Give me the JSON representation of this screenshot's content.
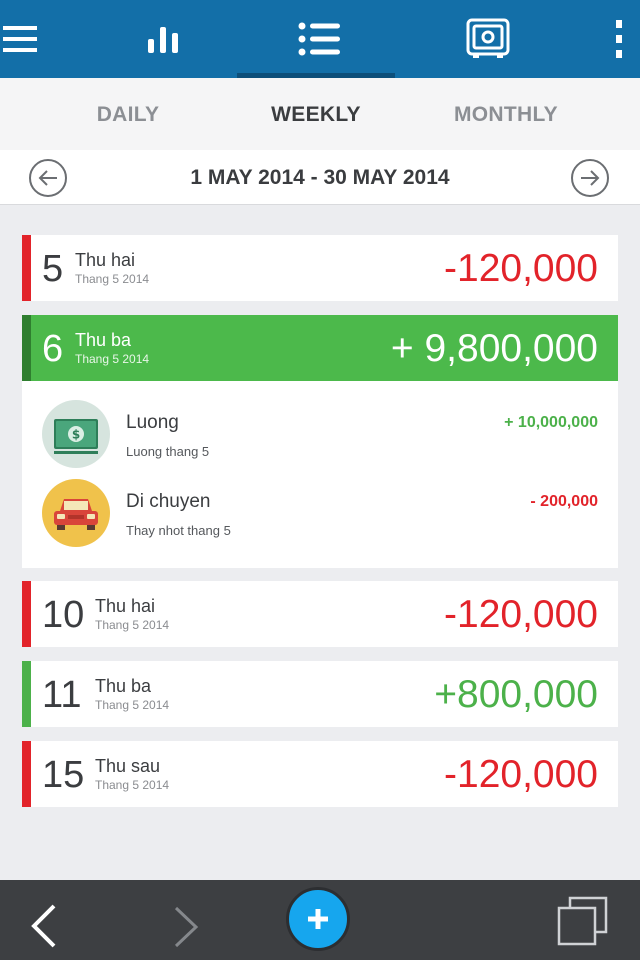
{
  "tabs": {
    "daily": "DAILY",
    "weekly": "WEEKLY",
    "monthly": "MONTHLY"
  },
  "range": {
    "title": "1 MAY 2014 - 30 MAY 2014"
  },
  "days": [
    {
      "day": "5",
      "weekday": "Thu hai",
      "month": "Thang 5 2014",
      "amount": "-120,000"
    },
    {
      "day": "6",
      "weekday": "Thu ba",
      "month": "Thang 5 2014",
      "amount": "+ 9,800,000"
    },
    {
      "day": "10",
      "weekday": "Thu hai",
      "month": "Thang 5 2014",
      "amount": "-120,000"
    },
    {
      "day": "11",
      "weekday": "Thu ba",
      "month": "Thang 5 2014",
      "amount": "+800,000"
    },
    {
      "day": "15",
      "weekday": "Thu sau",
      "month": "Thang 5 2014",
      "amount": "-120,000"
    }
  ],
  "transactions": [
    {
      "name": "Luong",
      "note": "Luong thang 5",
      "amount": "+ 10,000,000",
      "icon": "money-icon"
    },
    {
      "name": "Di chuyen",
      "note": "Thay nhot thang 5",
      "amount": "- 200,000",
      "icon": "car-icon"
    }
  ],
  "colors": {
    "header": "#136fa8",
    "income": "#4cb94b",
    "expense": "#e2232a",
    "fab": "#16a6ee"
  }
}
